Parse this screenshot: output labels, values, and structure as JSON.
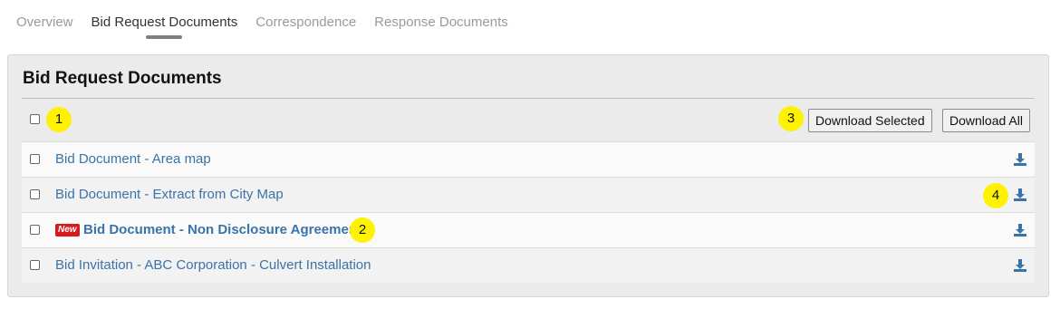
{
  "tabs": [
    {
      "label": "Overview",
      "active": false
    },
    {
      "label": "Bid Request Documents",
      "active": true
    },
    {
      "label": "Correspondence",
      "active": false
    },
    {
      "label": "Response Documents",
      "active": false
    }
  ],
  "panel": {
    "title": "Bid Request Documents",
    "toolbar": {
      "download_selected_label": "Download Selected",
      "download_all_label": "Download All"
    },
    "documents": [
      {
        "name": "Bid Document - Area map",
        "is_new": false
      },
      {
        "name": "Bid Document - Extract from City Map",
        "is_new": false
      },
      {
        "name": "Bid Document - Non Disclosure Agreement",
        "is_new": true,
        "badge": "New"
      },
      {
        "name": "Bid Invitation - ABC Corporation - Culvert Installation",
        "is_new": false
      }
    ]
  },
  "callouts": [
    "1",
    "2",
    "3",
    "4"
  ],
  "icons": {
    "download": "download-icon"
  },
  "colors": {
    "link": "#3a73a8",
    "badge": "#d91a1a",
    "callout": "#fff200",
    "icon": "#3a73a8"
  }
}
